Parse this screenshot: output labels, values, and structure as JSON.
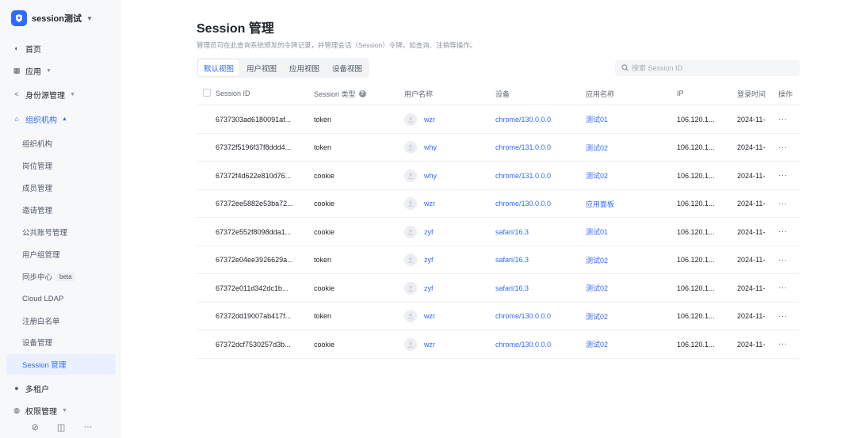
{
  "org": {
    "name": "session测试"
  },
  "sidebar": {
    "items": [
      {
        "label": "首页",
        "icon": "home-icon"
      },
      {
        "label": "应用",
        "icon": "apps-icon"
      },
      {
        "label": "身份源管理",
        "icon": "share-icon"
      },
      {
        "label": "组织机构",
        "icon": "org-icon"
      },
      {
        "label": "多租户",
        "icon": "tenant-icon"
      },
      {
        "label": "权限管理",
        "icon": "lock-icon"
      }
    ],
    "sub_items": [
      "组织机构",
      "岗位管理",
      "成员管理",
      "邀请管理",
      "公共账号管理",
      "用户组管理",
      "同步中心",
      "Cloud LDAP",
      "注册白名单",
      "设备管理",
      "Session 管理"
    ],
    "beta_badge": "beta",
    "footer_more": "···"
  },
  "page": {
    "title": "Session 管理",
    "description": "管理员可在此查询系统颁发的令牌记录，并管理会话（Session）令牌，如查询、注销等操作。"
  },
  "tabs": [
    "默认视图",
    "用户视图",
    "应用视图",
    "设备视图"
  ],
  "search": {
    "placeholder": "搜索 Session ID"
  },
  "table": {
    "headers": {
      "id": "Session ID",
      "type": "Session 类型",
      "user": "用户名称",
      "device": "设备",
      "app": "应用名称",
      "ip": "IP",
      "time": "登录时间",
      "op": "操作"
    },
    "rows": [
      {
        "id": "6737303ad6180091af...",
        "type": "token",
        "user": "wzr",
        "device": "chrome/130.0.0.0",
        "app": "测试01",
        "ip": "106.120.1...",
        "time": "2024-11-"
      },
      {
        "id": "67372f5196f37f8ddd4...",
        "type": "token",
        "user": "why",
        "device": "chrome/131.0.0.0",
        "app": "测试02",
        "ip": "106.120.1...",
        "time": "2024-11-"
      },
      {
        "id": "67372f4d622e810d76...",
        "type": "cookie",
        "user": "why",
        "device": "chrome/131.0.0.0",
        "app": "测试02",
        "ip": "106.120.1...",
        "time": "2024-11-"
      },
      {
        "id": "67372ee5882e53ba72...",
        "type": "cookie",
        "user": "wzr",
        "device": "chrome/130.0.0.0",
        "app": "应用面板",
        "ip": "106.120.1...",
        "time": "2024-11-"
      },
      {
        "id": "67372e552f8098dda1...",
        "type": "cookie",
        "user": "zyf",
        "device": "safari/16.3",
        "app": "测试01",
        "ip": "106.120.1...",
        "time": "2024-11-"
      },
      {
        "id": "67372e04ee3926629a...",
        "type": "token",
        "user": "zyf",
        "device": "safari/16.3",
        "app": "测试02",
        "ip": "106.120.1...",
        "time": "2024-11-"
      },
      {
        "id": "67372e011d342dc1b...",
        "type": "cookie",
        "user": "zyf",
        "device": "safari/16.3",
        "app": "测试02",
        "ip": "106.120.1...",
        "time": "2024-11-"
      },
      {
        "id": "67372dd19007ab417f...",
        "type": "token",
        "user": "wzr",
        "device": "chrome/130.0.0.0",
        "app": "测试02",
        "ip": "106.120.1...",
        "time": "2024-11-"
      },
      {
        "id": "67372dcf7530257d3b...",
        "type": "cookie",
        "user": "wzr",
        "device": "chrome/130.0.0.0",
        "app": "测试02",
        "ip": "106.120.1...",
        "time": "2024-11-"
      }
    ],
    "row_action": "···"
  },
  "colors": {
    "accent": "#2f6bff",
    "sidebar_bg": "#f7f8fa",
    "active_bg": "#eaf0ff"
  }
}
